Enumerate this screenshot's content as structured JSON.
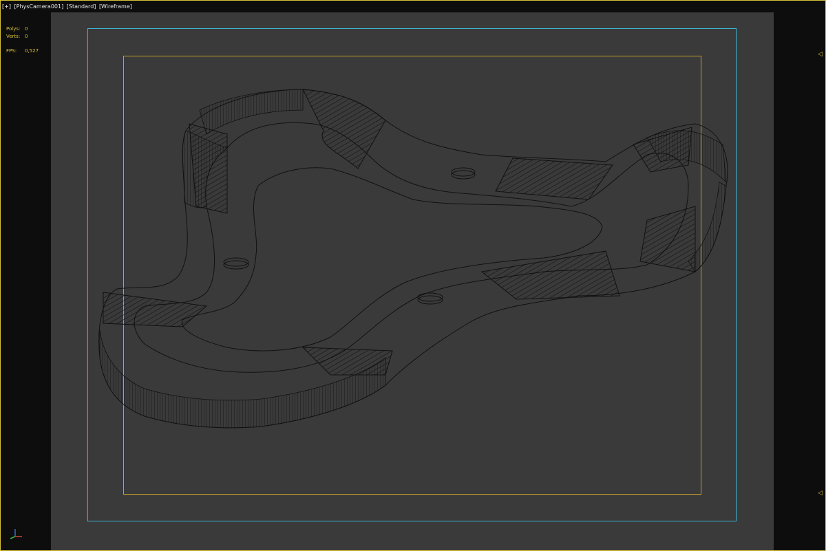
{
  "viewport": {
    "labels": {
      "menu": "[+]",
      "camera": "[PhysCamera001]",
      "shading": "[Standard]",
      "mode": "[Wireframe]"
    },
    "stats": {
      "polys_label": "Polys:",
      "polys_value": "0",
      "verts_label": "Verts:",
      "verts_value": "0",
      "fps_label": "FPS:",
      "fps_value": "0,527"
    },
    "colors": {
      "background": "#3a3a3a",
      "gutter": "#0d0d0d",
      "safe_frame": "#3ab6d6",
      "render_frame": "#c8a42a",
      "wire": "#111111",
      "text": "#e8e8e8",
      "stats_text": "#d8c23a"
    },
    "markers": [
      "arrow-left-icon",
      "arrow-left-icon"
    ],
    "gizmo": "axis-tripod-icon"
  }
}
